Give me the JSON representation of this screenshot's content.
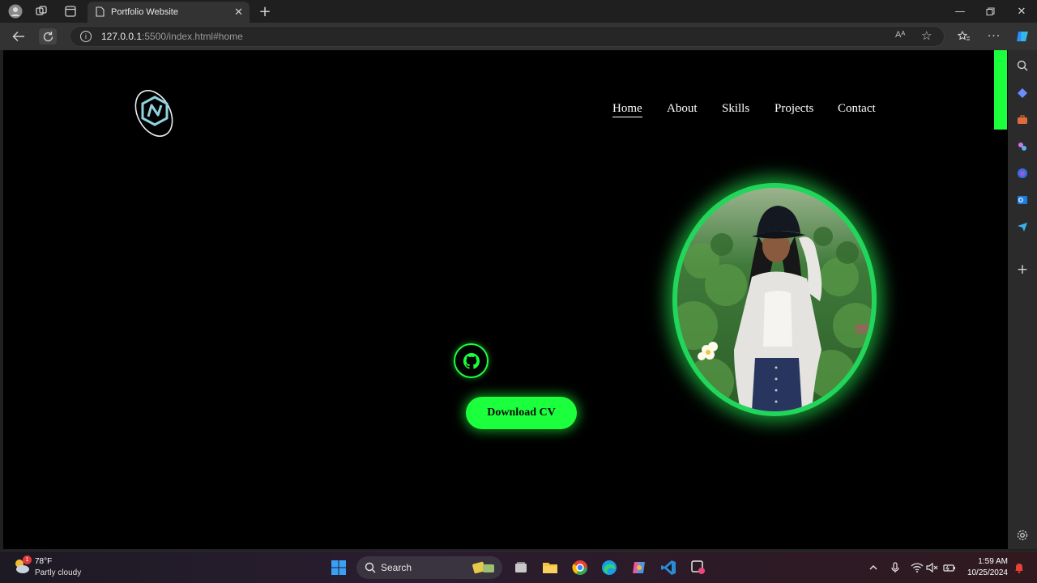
{
  "browser": {
    "tab_title": "Portfolio Website",
    "url_host": "127.0.0.1",
    "url_path": ":5500/index.html#home"
  },
  "page": {
    "nav": [
      {
        "label": "Home",
        "active": true
      },
      {
        "label": "About",
        "active": false
      },
      {
        "label": "Skills",
        "active": false
      },
      {
        "label": "Projects",
        "active": false
      },
      {
        "label": "Contact",
        "active": false
      }
    ],
    "cv_button": "Download CV",
    "accent_color": "#1cff3c"
  },
  "taskbar": {
    "weather_badge": "1",
    "temperature": "78°F",
    "condition": "Partly cloudy",
    "search_label": "Search",
    "time": "1:59 AM",
    "date": "10/25/2024"
  }
}
